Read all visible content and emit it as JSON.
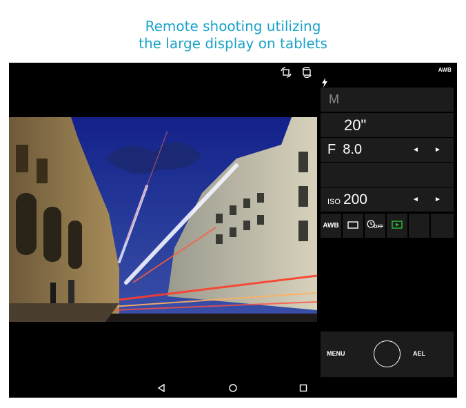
{
  "headline": {
    "line1": "Remote shooting utilizing",
    "line2": "the large display on tablets"
  },
  "status": {
    "white_balance": "AWB",
    "flash_icon": "flash-icon",
    "top_icons": [
      "rotate-crop-icon",
      "swap-camera-icon"
    ]
  },
  "panel": {
    "mode": "M",
    "shutter_speed": "20\"",
    "aperture_prefix": "F",
    "aperture": "8.0",
    "iso_prefix": "ISO",
    "iso": "200",
    "prev_arrow": "◄",
    "next_arrow": "►",
    "settings": {
      "white_balance": "AWB",
      "drive_icon": "single-shot-icon",
      "self_timer_icon": "self-timer-off-icon",
      "auto_review_icon": "auto-review-icon"
    }
  },
  "controls": {
    "menu": "MENU",
    "ael": "AEL"
  },
  "colors": {
    "headline": "#1aa3c9",
    "panel_bg": "#1c1c1c",
    "review_green": "#2ec13a",
    "sky": "#1a2e8a"
  },
  "nav_icons": [
    "back-icon",
    "home-icon",
    "recents-icon"
  ]
}
